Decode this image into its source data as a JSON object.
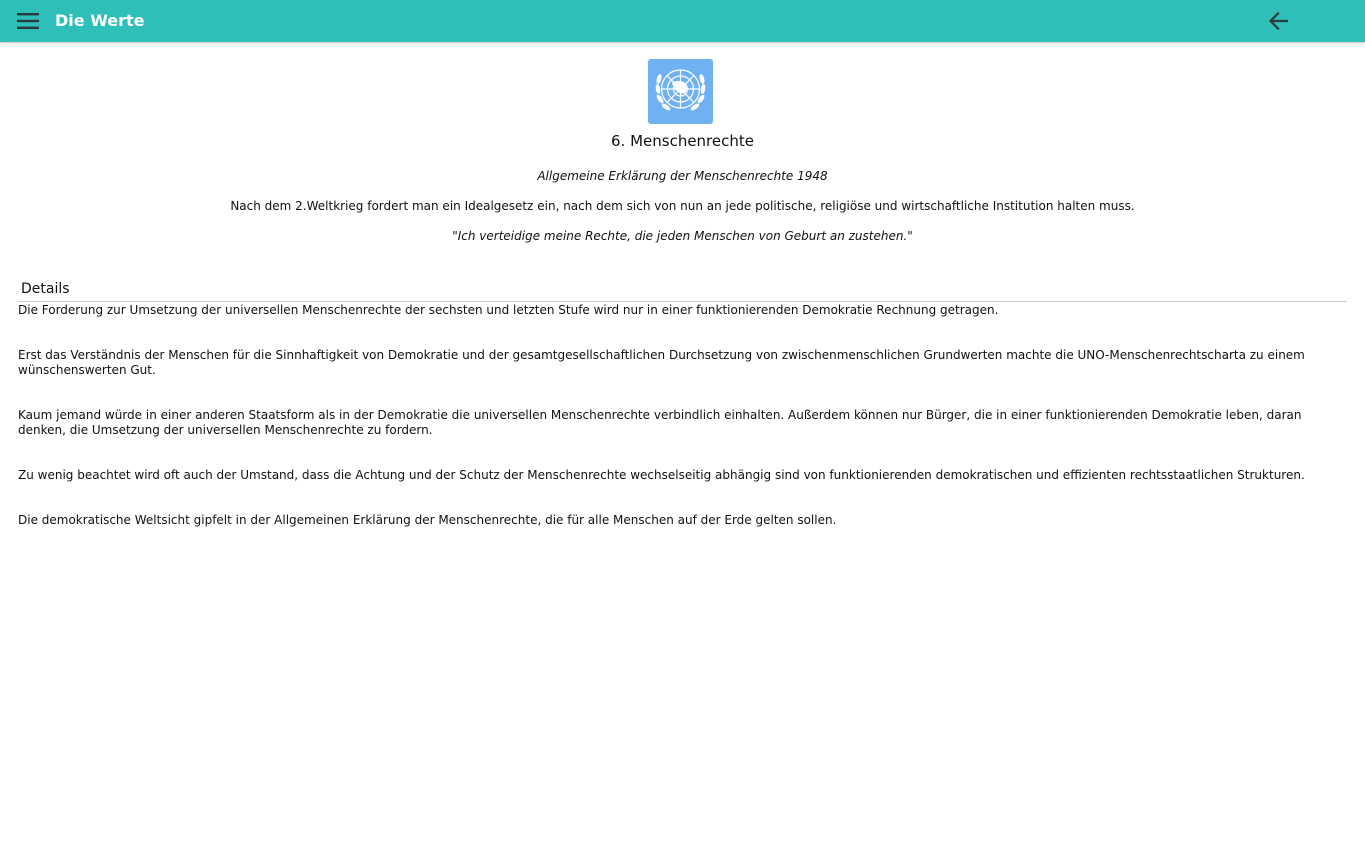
{
  "header": {
    "title": "Die Werte",
    "menu_icon": "hamburger-menu-icon",
    "back_icon": "arrow-back-icon",
    "background_color": "#2ebfb8"
  },
  "logo": {
    "icon": "un-emblem-icon",
    "background_color": "#70b1f2"
  },
  "content": {
    "heading": "6. Menschenrechte",
    "subtitle": "Allgemeine Erklärung der Menschenrechte 1948",
    "intro": "Nach dem 2.Weltkrieg fordert man ein Idealgesetz ein, nach dem sich von nun an jede politische, religiöse und wirtschaftliche Institution halten muss.",
    "quote": "\"Ich verteidige meine Rechte, die jeden Menschen von Geburt an zustehen.\""
  },
  "details": {
    "title": "Details",
    "paragraphs": [
      "Die Forderung zur Umsetzung der universellen Menschenrechte der sechsten und letzten Stufe wird nur in einer funktionierenden Demokratie Rechnung getragen.",
      "Erst das Verständnis der Menschen für die Sinnhaftigkeit von Demokratie und der gesamtgesellschaftlichen Durchsetzung von zwischenmenschlichen Grundwerten machte die UNO-Menschenrechtscharta zu einem wünschenswerten Gut.",
      "Kaum jemand würde in einer anderen Staatsform als in der Demokratie die universellen Menschenrechte verbindlich einhalten. Außerdem können nur Bürger, die in einer funktionierenden Demokratie leben, daran denken, die Umsetzung der universellen Menschenrechte zu fordern.",
      "Zu wenig beachtet wird oft auch der Umstand, dass die Achtung und der Schutz der Menschenrechte wechselseitig abhängig sind von funktionierenden demokratischen und effizienten rechtsstaatlichen Strukturen.",
      "Die demokratische Weltsicht gipfelt in der Allgemeinen Erklärung der Menschenrechte, die für alle Menschen auf der Erde gelten sollen."
    ]
  }
}
